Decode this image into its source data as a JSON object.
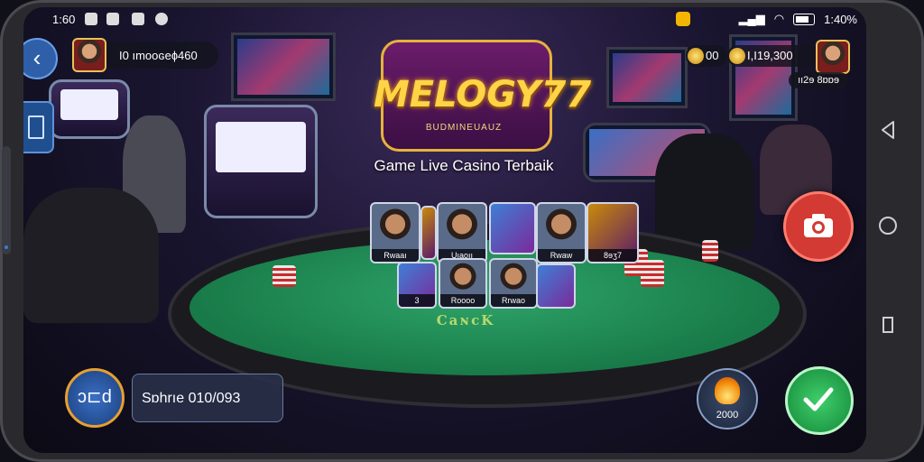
{
  "status_bar": {
    "time_left": "1:60",
    "time_right": "1:40%"
  },
  "header": {
    "user_id": "I0 ımooɢeɸ460",
    "coin_balance_1": "00",
    "coin_balance_2": "I,I19,300",
    "profile_tag": "ıı2ɘ 8ɒɒɘ"
  },
  "brand": {
    "logo_title": "MELOGY77",
    "logo_subtitle": "BUDMINEUAUZ",
    "tagline": "Game Live Casino Terbaik"
  },
  "game_grid": [
    {
      "kind": "face",
      "caption": "Rwaaı"
    },
    {
      "kind": "game",
      "caption": ""
    },
    {
      "kind": "face",
      "caption": "Uıaoıı"
    },
    {
      "kind": "game",
      "caption": ""
    },
    {
      "kind": "face",
      "caption": "Rwaw"
    },
    {
      "kind": "gold",
      "caption": "8ɘʒ7"
    },
    {
      "kind": "game",
      "caption": "3"
    },
    {
      "kind": "face",
      "caption": "Roooo"
    },
    {
      "kind": "face",
      "caption": "Rrwao"
    },
    {
      "kind": "game",
      "caption": ""
    }
  ],
  "table": {
    "felt_text": "CaɴcK"
  },
  "bottom": {
    "round_button_label": "ɔ⊏d",
    "pill_text": "Sɒhrıe 010/093",
    "fire_count": "2000"
  },
  "colors": {
    "felt": "#1f8f55",
    "accent_gold": "#e6b23b",
    "camera_red": "#d23a33",
    "confirm_green": "#25a94c"
  }
}
